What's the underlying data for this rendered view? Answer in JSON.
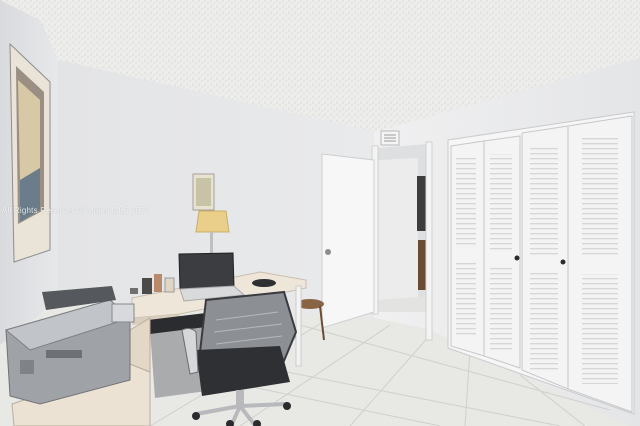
{
  "photo": {
    "watermark": "All Rights Reserved © Miami MLS 2025"
  },
  "palette": {
    "ceiling": "#ececea",
    "wall": "#e6e7e9",
    "wall_shadow": "#d3d4d7",
    "floor": "#e9e9e6",
    "door": "#f6f6f6",
    "desk_top": "#efe6da",
    "chair_mesh": "#8c8f94"
  }
}
